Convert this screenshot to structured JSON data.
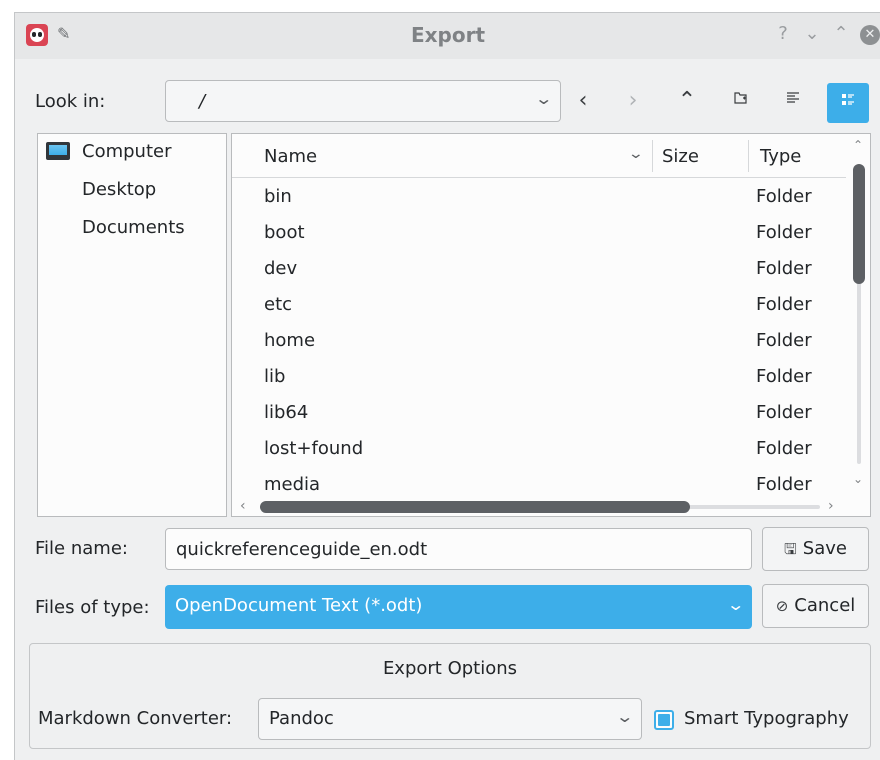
{
  "window": {
    "title": "Export",
    "controls": {
      "help": "?",
      "minimize": "⌄",
      "maximize": "⌃",
      "close": "✕"
    }
  },
  "toolbar": {
    "look_in_label": "Look in:",
    "look_in_value": "/",
    "back": "‹",
    "forward": "›",
    "up": "⌃",
    "icons": [
      "back-icon",
      "forward-icon",
      "up-icon",
      "new-folder-icon",
      "detail-view-icon",
      "list-view-icon"
    ]
  },
  "sidebar": {
    "items": [
      {
        "label": "Computer",
        "icon": "computer-icon"
      },
      {
        "label": "Desktop"
      },
      {
        "label": "Documents"
      }
    ]
  },
  "file_list": {
    "columns": [
      "Name",
      "Size",
      "Type"
    ],
    "rows": [
      {
        "name": "bin",
        "type": "Folder"
      },
      {
        "name": "boot",
        "type": "Folder"
      },
      {
        "name": "dev",
        "type": "Folder"
      },
      {
        "name": "etc",
        "type": "Folder"
      },
      {
        "name": "home",
        "type": "Folder"
      },
      {
        "name": "lib",
        "type": "Folder"
      },
      {
        "name": "lib64",
        "type": "Folder"
      },
      {
        "name": "lost+found",
        "type": "Folder"
      },
      {
        "name": "media",
        "type": "Folder"
      }
    ]
  },
  "form": {
    "file_name_label": "File name:",
    "file_name_value": "quickreferenceguide_en.odt",
    "file_type_label": "Files of type:",
    "file_type_value": "OpenDocument Text (*.odt)",
    "save_label": "Save",
    "cancel_label": "Cancel"
  },
  "export_options": {
    "title": "Export Options",
    "converter_label": "Markdown Converter:",
    "converter_value": "Pandoc",
    "smart_typography_label": "Smart Typography",
    "smart_typography_checked": true
  },
  "colors": {
    "accent": "#3daee9",
    "window_bg": "#eff0f1",
    "view_bg": "#fcfcfc",
    "text": "#232629"
  }
}
